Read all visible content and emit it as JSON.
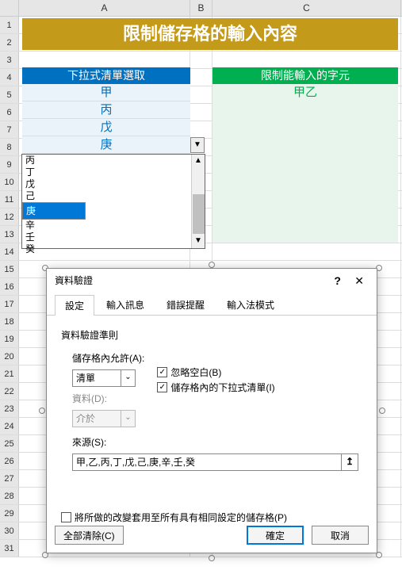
{
  "columns": [
    "A",
    "B",
    "C"
  ],
  "row_count": 31,
  "title_banner": "限制儲存格的輸入內容",
  "header_blue": "下拉式清單選取",
  "header_green": "限制能輸入的字元",
  "blue_values": [
    "甲",
    "丙",
    "戊",
    "庚"
  ],
  "green_value": "甲乙",
  "dropdown": {
    "items": [
      "丙",
      "丁",
      "戊",
      "己",
      "庚",
      "辛",
      "壬",
      "癸"
    ],
    "selected_index": 4
  },
  "dialog": {
    "title": "資料驗證",
    "help": "?",
    "close": "✕",
    "tabs": [
      "設定",
      "輸入訊息",
      "錯誤提醒",
      "輸入法模式"
    ],
    "active_tab": 0,
    "group": "資料驗證準則",
    "allow_label": "儲存格內允許(A):",
    "allow_value": "清單",
    "data_label": "資料(D):",
    "data_value": "介於",
    "chk_blank": "忽略空白(B)",
    "chk_dropdown": "儲存格內的下拉式清單(I)",
    "source_label": "來源(S):",
    "source_value": "甲,乙,丙,丁,戊,己,庚,辛,壬,癸",
    "apply_label": "將所做的改變套用至所有具有相同設定的儲存格(P)",
    "clear_btn": "全部清除(C)",
    "ok_btn": "確定",
    "cancel_btn": "取消"
  }
}
